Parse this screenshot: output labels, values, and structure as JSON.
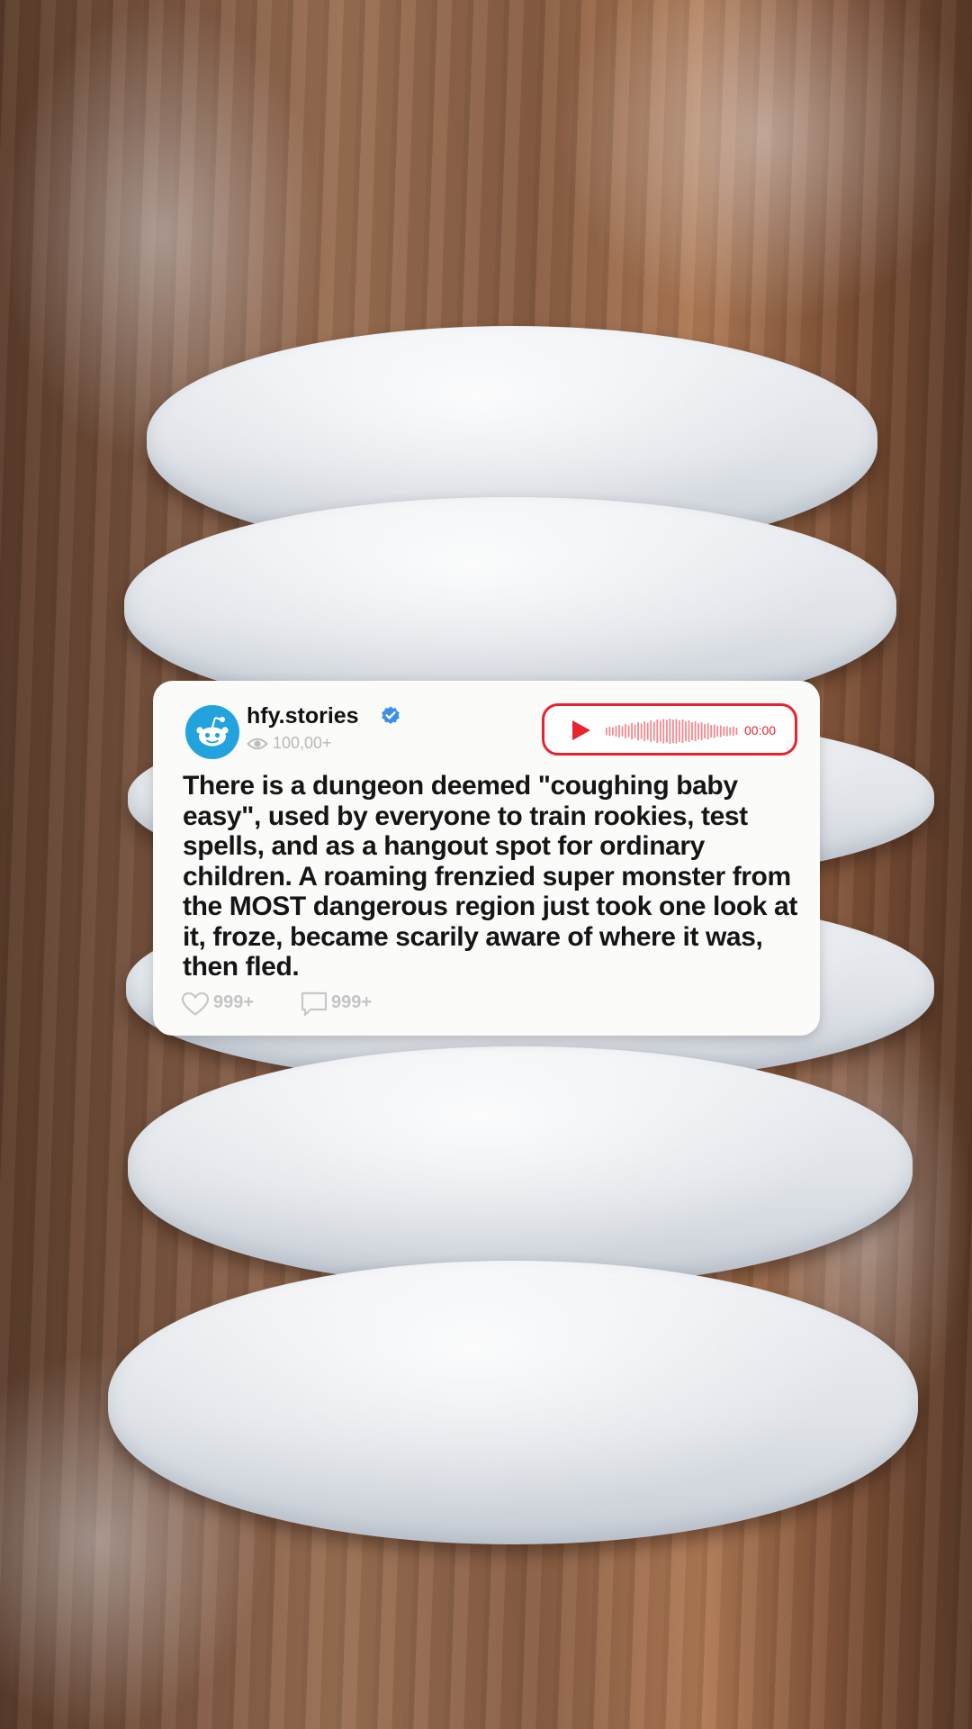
{
  "post": {
    "username": "hfy.stories",
    "views": "100,00+",
    "audio_duration": "00:00",
    "text": "There is a dungeon deemed \"coughing baby easy\", used by everyone to train rookies, test spells, and as a hangout spot for ordinary children. A roaming frenzied super monster from the MOST dangerous region just took one look at it, froze, became scarily aware of where it was, then fled.",
    "likes": "999+",
    "comments": "999+"
  },
  "icons": {
    "avatar": "reddit-snoo-icon",
    "verified": "verified-badge-icon",
    "views": "eye-icon",
    "play": "play-icon",
    "waveform": "waveform-icon",
    "like": "heart-icon",
    "comment": "comment-icon"
  },
  "colors": {
    "avatar_blue": "#22a3dd",
    "accent_red": "#e8232e",
    "verified_blue": "#3b8fe8",
    "card_background": "#fbfbfa"
  }
}
